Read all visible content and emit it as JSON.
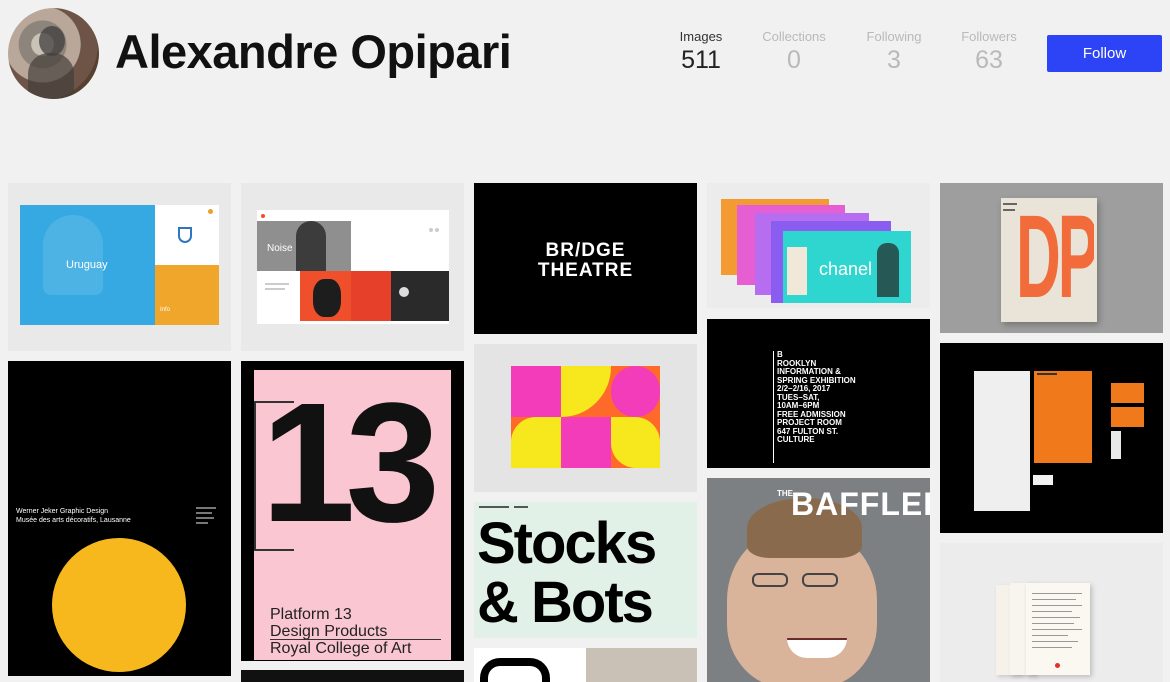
{
  "profile": {
    "name": "Alexandre Opipari"
  },
  "stats": [
    {
      "label": "Images",
      "value": "511"
    },
    {
      "label": "Collections",
      "value": "0"
    },
    {
      "label": "Following",
      "value": "3"
    },
    {
      "label": "Followers",
      "value": "63"
    }
  ],
  "follow_label": "Follow",
  "colors": {
    "accent": "#2d44f6",
    "background": "#f1f1f1"
  },
  "gallery": {
    "uruguay": {
      "title": "Uruguay",
      "info": "Info"
    },
    "noise": {
      "title": "Noise"
    },
    "bridge": {
      "line1": "BR/DGE",
      "line2": "THEATRE"
    },
    "chanel": {
      "title": "chanel"
    },
    "dps": {
      "title": "DPS"
    },
    "werner": {
      "line1": "Werner Jeker  Graphic Design",
      "line2": "Musée des arts décoratifs, Lausanne"
    },
    "platform": {
      "big": "13",
      "line1": "Platform 13",
      "line2": "Design Products",
      "line3": "Royal College of Art"
    },
    "brooklyn": {
      "lines": [
        "B",
        "ROOKLYN",
        "INFORMATION &",
        "SPRING EXHIBITION",
        "2/2–2/16, 2017",
        "TUES–SAT,",
        "10AM–6PM",
        "FREE ADMISSION",
        "PROJECT ROOM",
        "647 FULTON ST.",
        "CULTURE"
      ]
    },
    "stocks": {
      "line1": "Stocks",
      "line2": "& Bots"
    },
    "baffler": {
      "the": "THE",
      "title": "BAFFLER"
    }
  }
}
